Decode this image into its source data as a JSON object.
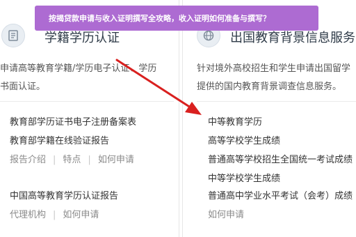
{
  "banner": {
    "text": "按揭贷款申请与收入证明撰写全攻略，收入证明如何准备与撰写？"
  },
  "left_card": {
    "title": "学籍学历认证",
    "icon": "document-icon",
    "desc_line1": "申请高等教育学籍/学历电子认证、学历",
    "desc_line2": "书面认证。",
    "items": [
      "教育部学历证书电子注册备案表",
      "教育部学籍在线验证报告"
    ],
    "links1": [
      "报告介绍",
      "特点",
      "如何申请"
    ],
    "item3": "中国高等教育学历认证报告",
    "links2": [
      "代理机构",
      "如何申请"
    ]
  },
  "right_card": {
    "title": "出国教育背景信息服务",
    "icon": "globe-icon",
    "desc_line1": "针对境外高校招生和学生申请出国留学",
    "desc_line2": "提供的国内教育背景调查信息服务。",
    "items": [
      "中等教育学历",
      "高等学校学生成绩",
      "普通高等学校招生全国统一考试成绩",
      "中等学校学生成绩",
      "普通高中学业水平考试（会考）成绩"
    ],
    "link": "如何申请"
  },
  "colors": {
    "banner": "#ad6bd2",
    "arrow": "#d9201f"
  }
}
